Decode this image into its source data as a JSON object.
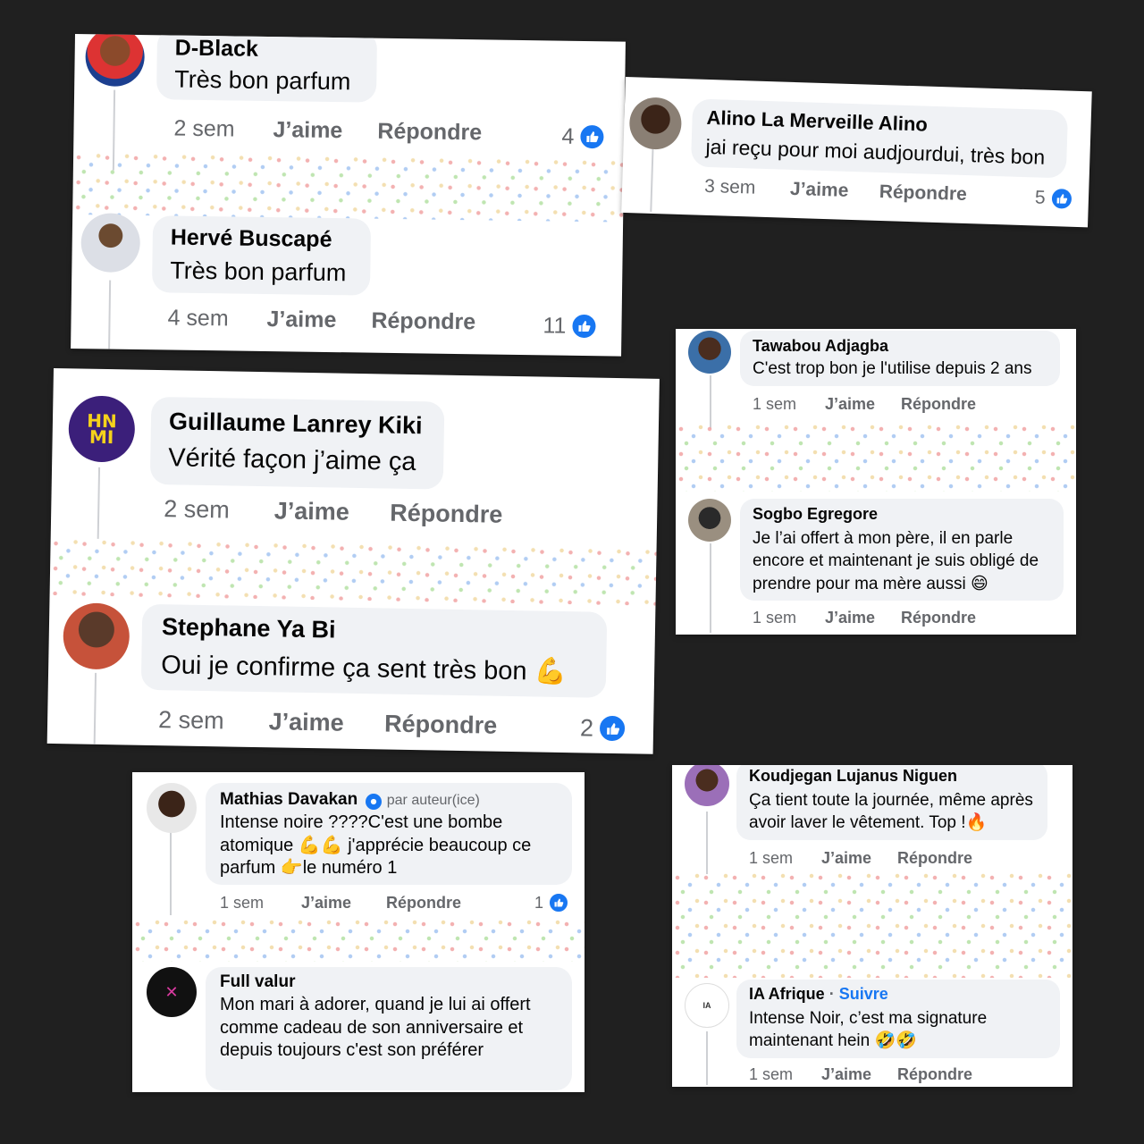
{
  "colors": {
    "background": "#202020",
    "card": "#ffffff",
    "bubble": "#f0f2f5",
    "like_blue": "#1877f2",
    "meta_gray": "#65676b"
  },
  "actions": {
    "like": "J’aime",
    "reply": "Répondre"
  },
  "cards": {
    "c1": {
      "comments": [
        {
          "author": "D-Black",
          "text": "Très bon parfum",
          "time": "2 sem",
          "likes": "4"
        },
        {
          "author": "Hervé Buscapé",
          "text": "Très bon parfum",
          "time": "4 sem",
          "likes": "11"
        }
      ]
    },
    "c2": {
      "comments": [
        {
          "author": "Alino La Merveille Alino",
          "text": "jai reçu pour moi audjourdui, très bon",
          "time": "3 sem",
          "likes": "5"
        }
      ]
    },
    "c3": {
      "comments": [
        {
          "author": "Guillaume Lanrey Kiki",
          "text": "Vérité façon j’aime ça",
          "time": "2 sem"
        },
        {
          "author": "Stephane Ya Bi",
          "text": "Oui je confirme ça sent très bon 💪",
          "time": "2 sem",
          "likes": "2"
        }
      ]
    },
    "c4": {
      "comments": [
        {
          "author": "Tawabou Adjagba",
          "text": "C'est trop bon je l'utilise depuis 2 ans",
          "time": "1 sem"
        },
        {
          "author": "Sogbo Egregore",
          "text": "Je l’ai offert à mon père, il en parle encore et maintenant je suis obligé de prendre pour ma mère aussi 😄",
          "time": "1 sem"
        }
      ]
    },
    "c5": {
      "comments": [
        {
          "author": "Mathias Davakan",
          "badge": "par auteur(ice)",
          "text": "Intense noire ????C'est une bombe atomique 💪💪 j'apprécie beaucoup ce parfum 👉le numéro 1",
          "time": "1 sem",
          "likes": "1"
        },
        {
          "author": "Full valur",
          "text": "Mon mari à adorer, quand je lui ai offert comme cadeau de son anniversaire et depuis toujours c'est son préférer"
        }
      ]
    },
    "c6": {
      "comments": [
        {
          "author": "Koudjegan Lujanus Niguen",
          "text": "Ça tient toute la journée, même après avoir laver le vêtement. Top !🔥",
          "time": "1 sem"
        },
        {
          "author": "IA Afrique",
          "follow": "Suivre",
          "text": "Intense Noir, c’est ma signature maintenant hein 🤣🤣",
          "time": "1 sem"
        }
      ]
    }
  }
}
